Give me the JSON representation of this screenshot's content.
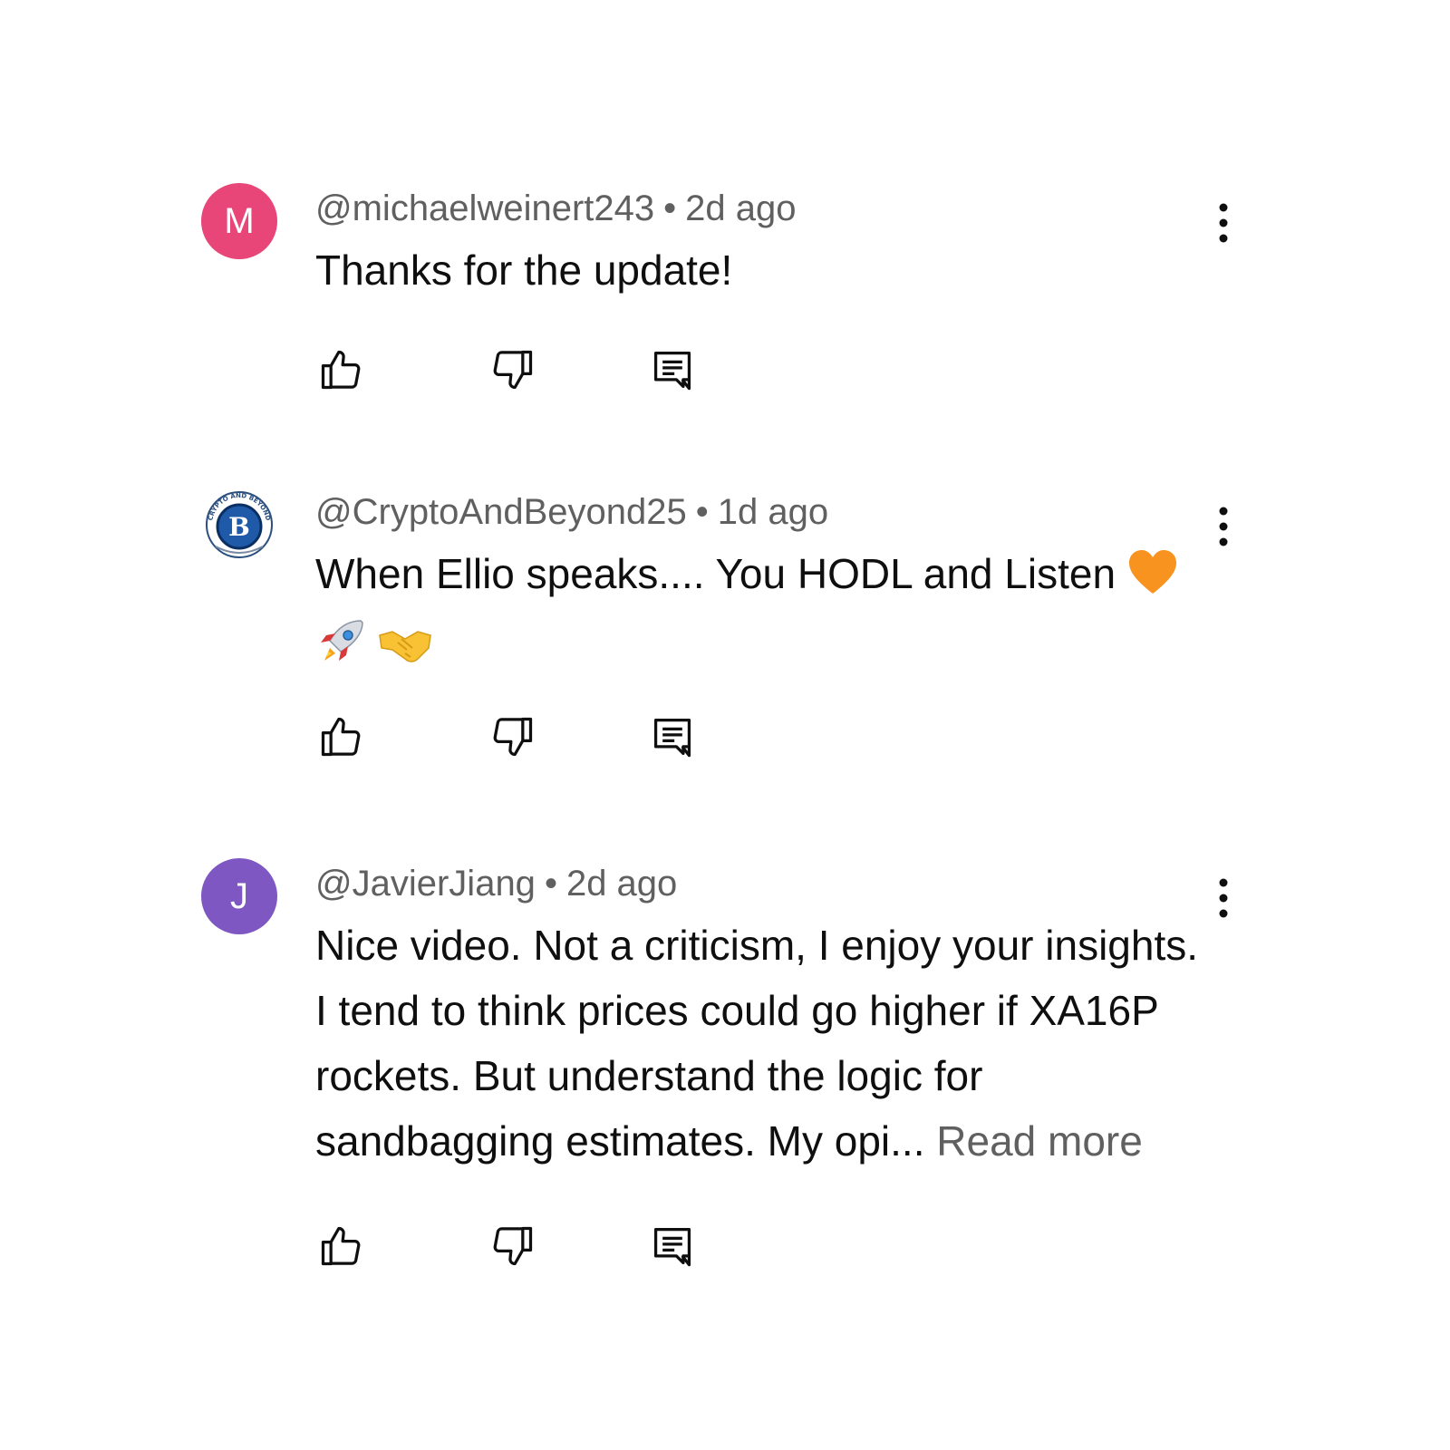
{
  "comments": [
    {
      "avatar_letter": "M",
      "avatar_color": "#e84579",
      "author": "@michaelweinert243",
      "separator": "•",
      "time": "2d ago",
      "text": "Thanks for the update!"
    },
    {
      "avatar_icon": "crypto-bitcoin-logo-icon",
      "avatar_logo_letter": "B",
      "avatar_logo_text": "CRYPTO AND BEYOND",
      "author": "@CryptoAndBeyond25",
      "separator": "•",
      "time": "1d ago",
      "text": "When Ellio speaks.... You HODL and Listen",
      "emojis": [
        "orange-heart-icon",
        "rocket-icon",
        "handshake-icon"
      ]
    },
    {
      "avatar_letter": "J",
      "avatar_color": "#7e57c2",
      "author": "@JavierJiang",
      "separator": "•",
      "time": "2d ago",
      "text": "Nice video. Not a criticism, I enjoy your insights. I tend to think prices could go higher if XA16P rockets. But understand the logic for sandbagging estimates. My opi...",
      "read_more": "Read more"
    }
  ],
  "action_icons": [
    "thumbs-up-icon",
    "thumbs-down-icon",
    "reply-icon"
  ],
  "more_icon": "more-vert-icon"
}
